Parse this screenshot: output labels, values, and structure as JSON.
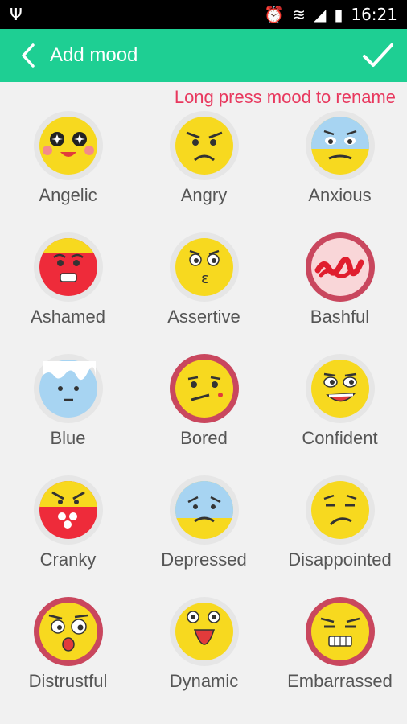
{
  "status": {
    "time": "16:21"
  },
  "appbar": {
    "title": "Add mood"
  },
  "hint": "Long press mood to rename",
  "moods": [
    {
      "label": "Angelic"
    },
    {
      "label": "Angry"
    },
    {
      "label": "Anxious"
    },
    {
      "label": "Ashamed"
    },
    {
      "label": "Assertive"
    },
    {
      "label": "Bashful"
    },
    {
      "label": "Blue"
    },
    {
      "label": "Bored"
    },
    {
      "label": "Confident"
    },
    {
      "label": "Cranky"
    },
    {
      "label": "Depressed"
    },
    {
      "label": "Disappointed"
    },
    {
      "label": "Distrustful"
    },
    {
      "label": "Dynamic"
    },
    {
      "label": "Embarrassed"
    }
  ]
}
